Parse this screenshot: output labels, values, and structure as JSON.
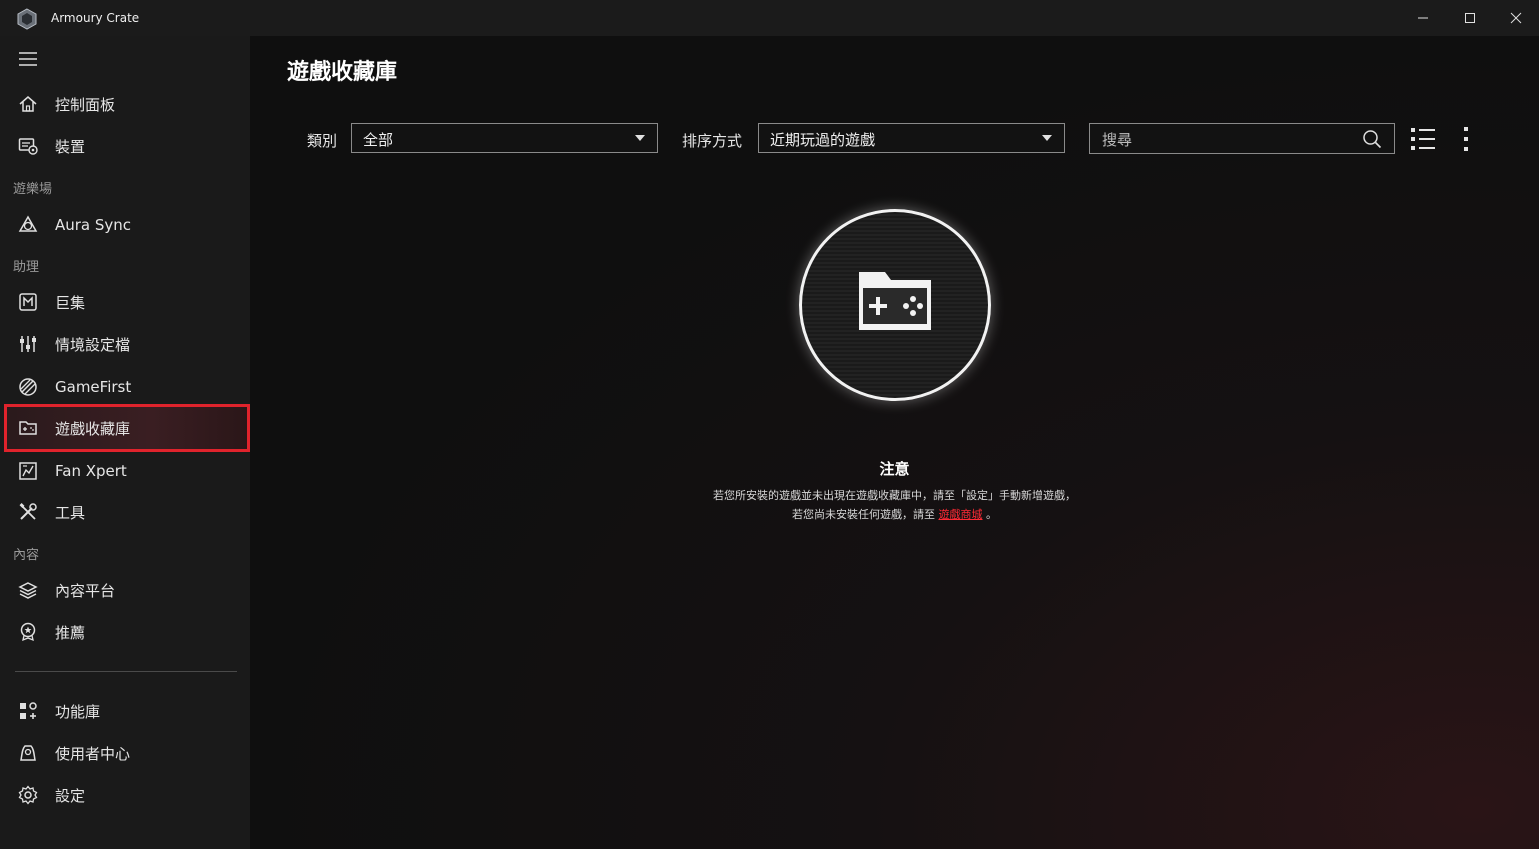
{
  "window": {
    "title": "Armoury Crate"
  },
  "sidebar": {
    "items": [
      {
        "label": "控制面板",
        "icon": "home-icon"
      },
      {
        "label": "裝置",
        "icon": "device-icon"
      },
      {
        "label": "Aura Sync",
        "icon": "aura-sync-icon"
      },
      {
        "label": "巨集",
        "icon": "macro-icon"
      },
      {
        "label": "情境設定檔",
        "icon": "scenario-profile-icon"
      },
      {
        "label": "GameFirst",
        "icon": "gamefirst-icon"
      },
      {
        "label": "遊戲收藏庫",
        "icon": "game-library-icon",
        "active": true
      },
      {
        "label": "Fan Xpert",
        "icon": "fan-xpert-icon"
      },
      {
        "label": "工具",
        "icon": "tools-icon"
      },
      {
        "label": "內容平台",
        "icon": "content-platform-icon"
      },
      {
        "label": "推薦",
        "icon": "recommend-icon"
      },
      {
        "label": "功能庫",
        "icon": "feature-library-icon"
      },
      {
        "label": "使用者中心",
        "icon": "user-center-icon"
      },
      {
        "label": "設定",
        "icon": "settings-icon"
      }
    ],
    "sections": {
      "playground": "遊樂場",
      "assistant": "助理",
      "content": "內容"
    }
  },
  "main": {
    "title": "遊戲收藏庫",
    "category_label": "類別",
    "category_value": "全部",
    "sort_label": "排序方式",
    "sort_value": "近期玩過的遊戲",
    "search_placeholder": "搜尋",
    "notice_title": "注意",
    "notice_line1": "若您所安裝的遊戲並未出現在遊戲收藏庫中，請至「設定」手動新增遊戲，",
    "notice_line2_prefix": "若您尚未安裝任何遊戲，請至",
    "notice_link": "遊戲商城",
    "notice_line2_suffix": "。"
  },
  "colors": {
    "accent": "#e0232c",
    "link": "#ff2a35"
  }
}
